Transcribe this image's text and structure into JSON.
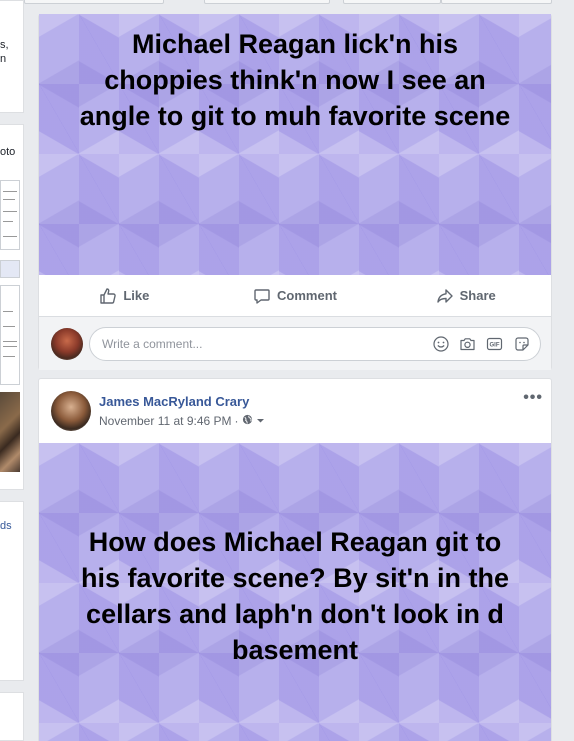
{
  "left_column": {
    "card1_lines": [
      "s,",
      "n"
    ],
    "card2_label": "oto",
    "card3_label": "ds"
  },
  "post1": {
    "status_text": "Michael Reagan lick'n his choppies think'n now I see an angle to git to muh favorite scene",
    "actions": {
      "like_label": "Like",
      "comment_label": "Comment",
      "share_label": "Share"
    },
    "comment_placeholder": "Write a comment..."
  },
  "post2": {
    "author": "James MacRyland Crary",
    "timestamp": "November 11 at 9:46 PM",
    "separator": "·",
    "more_label": "•••",
    "status_text": "How does Michael Reagan git to his favorite scene? By sit'n in the cellars and laph'n don't look in d basement"
  },
  "icons": {
    "like": "thumbs-up-icon",
    "comment": "speech-bubble-icon",
    "share": "share-arrow-icon",
    "emoji": "smiley-icon",
    "camera": "camera-icon",
    "gif": "gif-icon",
    "sticker": "sticker-icon",
    "privacy": "globe-icon",
    "dropdown": "caret-down-icon"
  },
  "colors": {
    "page_bg": "#e9ebee",
    "purple_bg": "#b7b0ec",
    "author_link": "#385898",
    "action_text": "#606770"
  }
}
